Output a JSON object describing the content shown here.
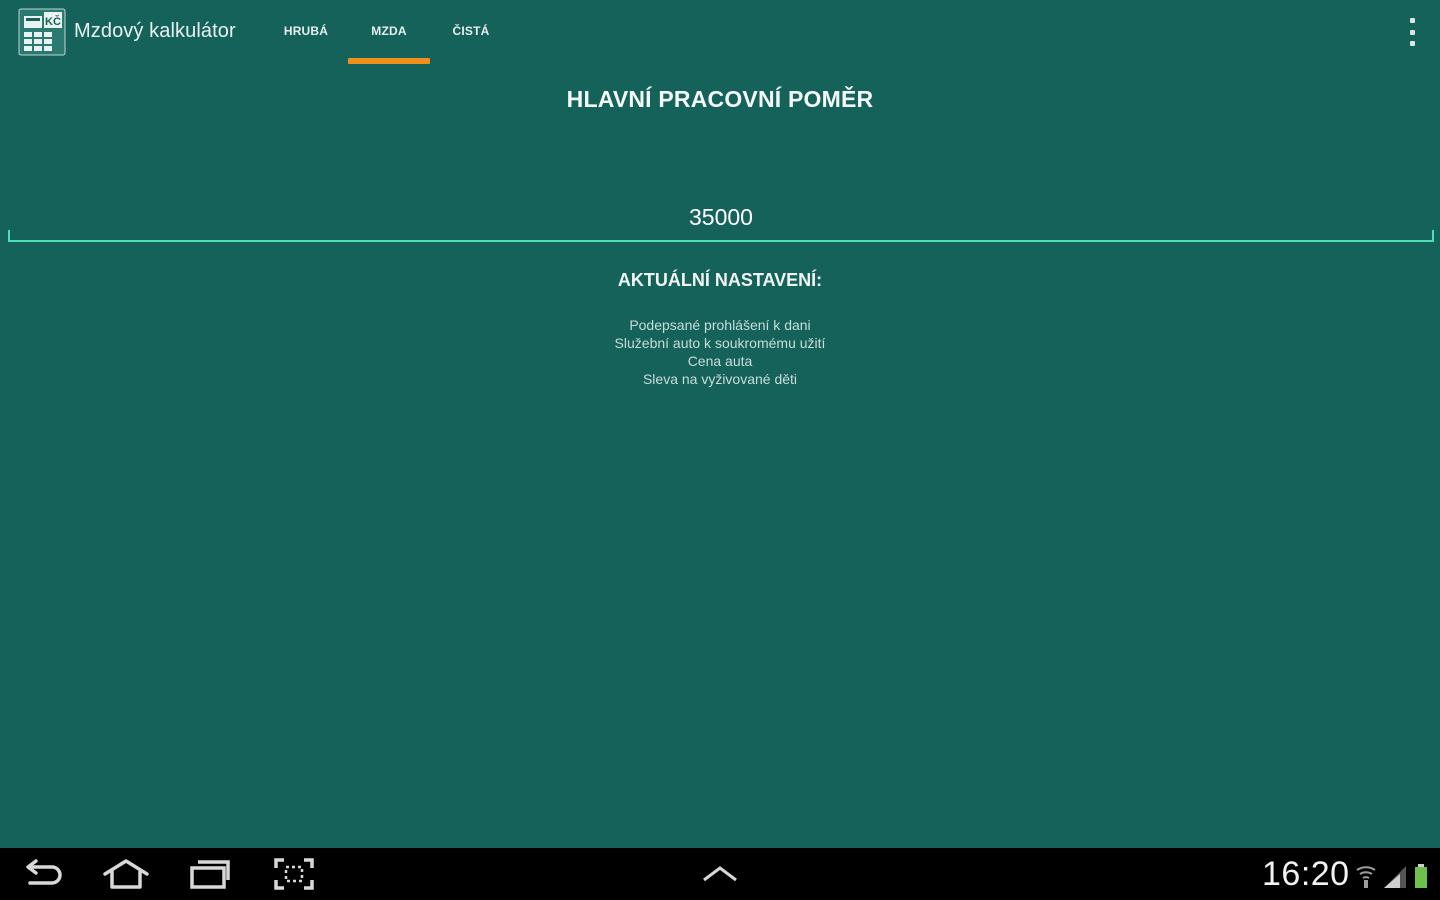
{
  "app": {
    "title": "Mzdový kalkulátor",
    "icon": "calculator-icon",
    "accent_color": "#f0901c",
    "background_color": "#15625b"
  },
  "tabs": [
    {
      "label": "HRUBÁ",
      "selected": false
    },
    {
      "label": "MZDA",
      "selected": true
    },
    {
      "label": "ČISTÁ",
      "selected": false
    }
  ],
  "main": {
    "heading": "HLAVNÍ PRACOVNÍ POMĚR",
    "amount_value": "35000",
    "settings_title": "AKTUÁLNÍ NASTAVENÍ:",
    "settings_items": [
      "Podepsané prohlášení k dani",
      "Služební auto k soukromému užití",
      "Cena auta",
      "Sleva na vyživované děti"
    ]
  },
  "system": {
    "clock": "16:20",
    "nav_icons": [
      "back-icon",
      "home-icon",
      "recent-apps-icon",
      "screenshot-icon",
      "chevron-up-icon"
    ],
    "status_icons": [
      "wifi-icon",
      "signal-icon",
      "battery-icon"
    ]
  }
}
